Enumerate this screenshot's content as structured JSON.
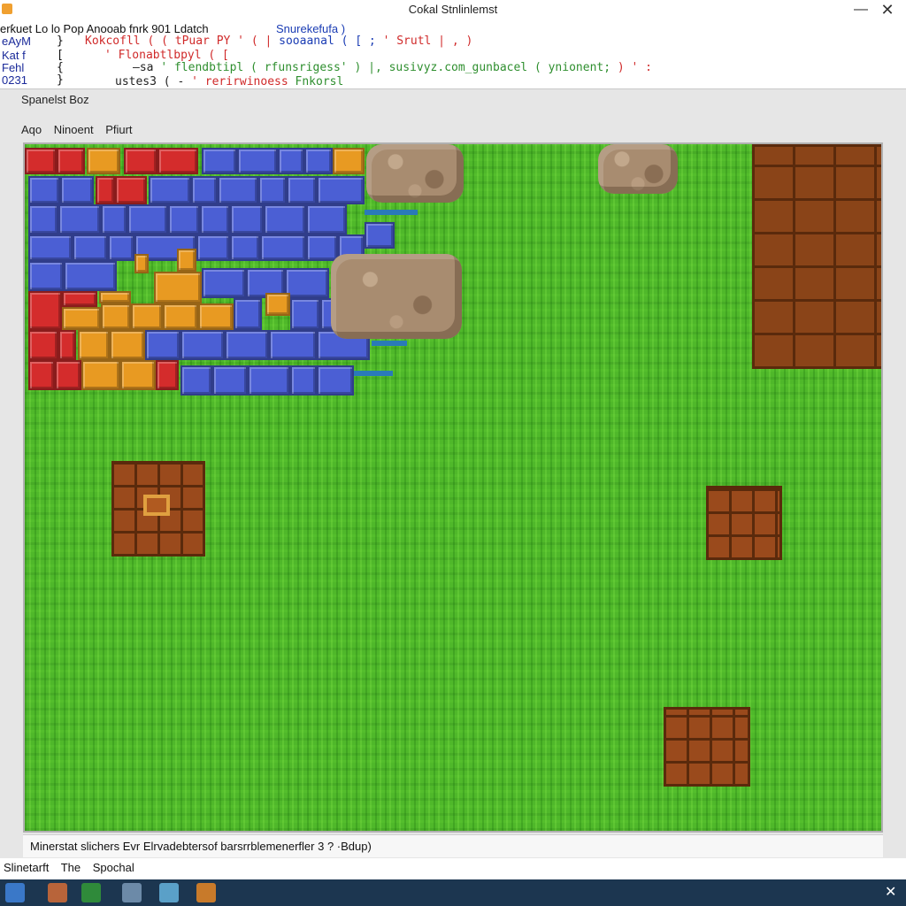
{
  "window": {
    "title": "Coƙal Stnlinlemst",
    "minimize_glyph": "—",
    "close_glyph": "✕"
  },
  "menu": {
    "items": "erƙuet   Lo   lo   Pop   Anooab   fnrk   901   Ldatch",
    "source": "Snurekefufa )"
  },
  "code": {
    "gutter": [
      "eAyM",
      "Kat f",
      "Fehl",
      "0231"
    ],
    "braces": [
      "}",
      "[",
      "{",
      "}"
    ],
    "line1_red": "Kokcofll ( ( tPuar PY ' ( |",
    "line1_blue": "sooaanal ( [ ;",
    "line1_red2": "' Srutl | ,  )",
    "line2_red": "' Flonabtlbpyl ( [",
    "line3_dark": "—sa",
    "line3_green": "' flendbtipl ( rfunsrigess' ) |, susivyz.com_gunbacel ( ynionent;",
    "line3_red": " ) ' :",
    "line4_dark": "ustes3 (  -",
    "line4_red": "' rerirwinoess",
    "line4_green": "  Fnkorsl"
  },
  "panel": {
    "label": "Spanelst   Boz",
    "tabs": [
      "Aqo",
      "Ninoent",
      "Pfiurt"
    ]
  },
  "status": {
    "text": "Minerstat slichers   Evr   Elrvadebtersof barsrrblemenerfler 3 ? ·Bdup)"
  },
  "bottom": {
    "items": [
      "Slinetarft",
      "The",
      "Spochal"
    ]
  },
  "colors": {
    "grass": "#4fb82a",
    "taskbar": "#1c3650",
    "brick": "#8a4418"
  },
  "icons": [
    "app-icon",
    "file-explorer-icon",
    "folder-icon",
    "terminal-icon",
    "editor-icon",
    "window-icon",
    "game-icon"
  ]
}
